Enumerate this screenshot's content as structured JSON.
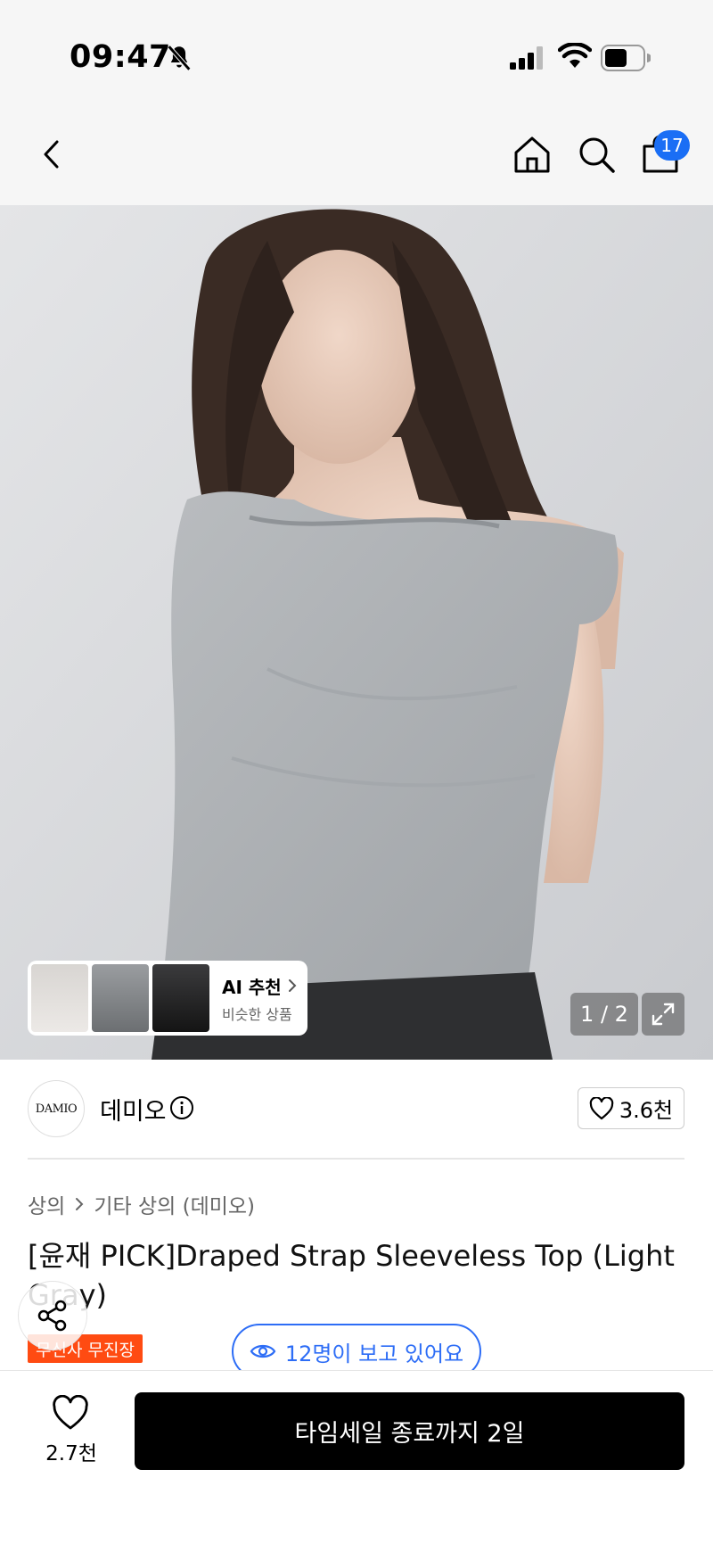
{
  "status_bar": {
    "time": "09:47",
    "icons": [
      "bell-slash-icon",
      "cellular-signal-icon",
      "wifi-icon",
      "battery-icon"
    ]
  },
  "nav": {
    "icons": [
      "back-icon",
      "home-icon",
      "search-icon",
      "shopping-bag-icon"
    ],
    "cart_count": "17"
  },
  "hero": {
    "ai_title": "AI 추천",
    "ai_subtitle": "비슷한 상품",
    "counter": "1 / 2",
    "ai_thumbnails": [
      "white",
      "gray",
      "black"
    ]
  },
  "brand": {
    "logo_text": "DAMIO",
    "name": "데미오",
    "likes": "3.6천"
  },
  "breadcrumb": {
    "category": "상의",
    "subcategory": "기타 상의 (데미오)"
  },
  "product": {
    "title": "[윤재 PICK]Draped Strap Sleeveless Top (Light Gray)",
    "exclusive_badge": "무신사 무진장",
    "viewers": "12명이 보고 있어요"
  },
  "bottom_bar": {
    "wish_count": "2.7천",
    "cta_label": "타임세일 종료까지 2일"
  },
  "colors": {
    "accent_blue": "#2d6df6",
    "badge_orange": "#ff4b12",
    "cta_black": "#000000"
  }
}
